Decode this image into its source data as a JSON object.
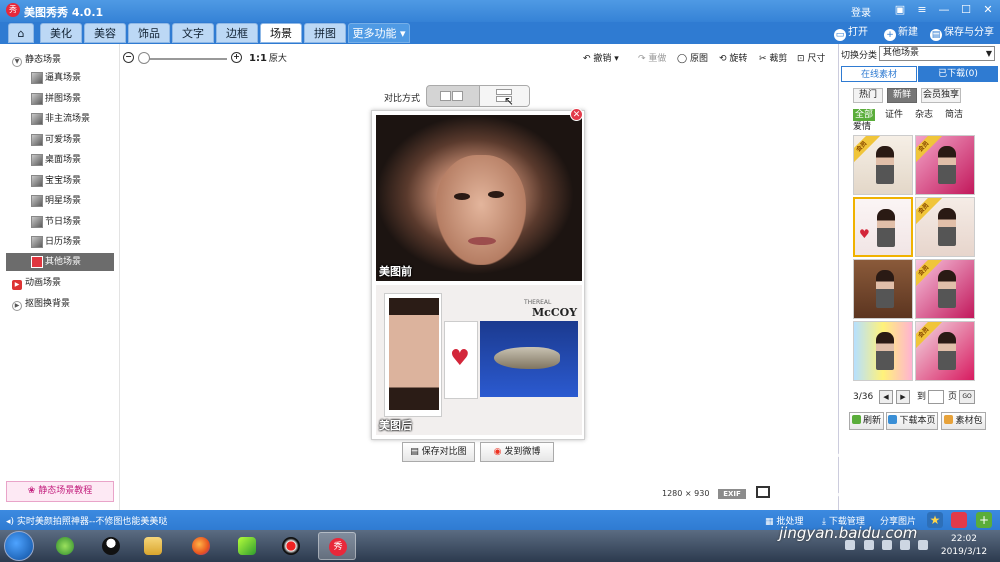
{
  "window": {
    "title": "美图秀秀 4.0.1",
    "login": "登录",
    "logo_glyph": "秀"
  },
  "tabs": [
    {
      "label": "⌂",
      "id": "home"
    },
    {
      "label": "美化",
      "id": "beautify"
    },
    {
      "label": "美容",
      "id": "cosmetic"
    },
    {
      "label": "饰品",
      "id": "accessory"
    },
    {
      "label": "文字",
      "id": "text"
    },
    {
      "label": "边框",
      "id": "frame"
    },
    {
      "label": "场景",
      "id": "scene",
      "active": true
    },
    {
      "label": "拼图",
      "id": "collage"
    },
    {
      "label": "更多功能 ▾",
      "id": "more"
    }
  ],
  "top_actions": {
    "open": "打开",
    "new": "新建",
    "save_share": "保存与分享"
  },
  "left_tree": {
    "static_root": "静态场景",
    "static_items": [
      "逼真场景",
      "拼图场景",
      "非主流场景",
      "可爱场景",
      "桌面场景",
      "宝宝场景",
      "明星场景",
      "节日场景",
      "日历场景",
      "其他场景"
    ],
    "active_item": 9,
    "animated": "动画场景",
    "cutout": "抠图换背景",
    "tutorial": "静态场景教程"
  },
  "toolbar": {
    "zoom_ratio": "1:1",
    "original_size": "原大",
    "undo": "撤销",
    "redo": "重做",
    "original": "原图",
    "rotate": "旋转",
    "crop": "裁剪",
    "size": "尺寸"
  },
  "workspace": {
    "compare_label": "对比方式",
    "before_label": "美图前",
    "after_label": "美图后",
    "after_brand_small": "THEREAL",
    "after_brand": "McCOY",
    "save_compare": "保存对比图",
    "post_weibo": "发到微博",
    "dimensions": "1280 × 930",
    "exif": "EXIF"
  },
  "right_panel": {
    "switch_label": "切换分类",
    "switch_value": "其他场景",
    "tab_online": "在线素材",
    "tab_downloaded": "已下载(0)",
    "filters": [
      "热门",
      "新鲜",
      "会员独享"
    ],
    "active_filter": 1,
    "categories": [
      "全部",
      "证件",
      "杂志",
      "简洁",
      "爱情"
    ],
    "vip_tag": "会员",
    "page_info": "3/36",
    "page_to": "到",
    "page_unit": "页",
    "go": "GO",
    "refresh": "刷新",
    "download_page": "下载本页",
    "library": "素材包"
  },
  "statusbar": {
    "message": "实时美颜拍照神器--不修图也能美美哒",
    "batch": "批处理",
    "download_manage": "下载管理",
    "share_image": "分享图片"
  },
  "taskbar": {
    "time": "22:02",
    "date": "2019/3/12"
  },
  "watermark": {
    "text": "jingyan.baidu.com"
  },
  "colors": {
    "titlebar": "#3582d6",
    "accent_green": "#5aad3a",
    "vip": "#f0c53a",
    "close_red": "#e23a4a"
  }
}
